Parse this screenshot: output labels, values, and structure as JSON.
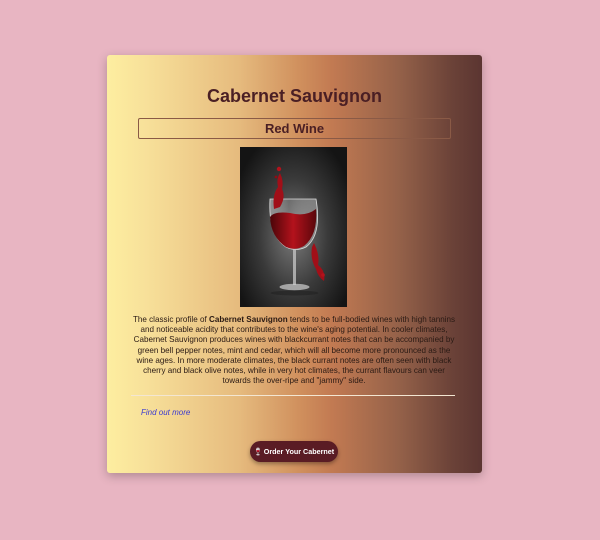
{
  "card": {
    "title": "Cabernet Sauvignon",
    "subtitle": "Red Wine",
    "image_alt": "Red wine splashing in a glass",
    "description_prefix": "The classic profile of ",
    "description_bold": "Cabernet Sauvignon",
    "description_suffix": " tends to be full-bodied wines with high tannins and noticeable acidity that contributes to the wine's aging potential. In cooler climates, Cabernet Sauvignon produces wines with blackcurrant notes that can be accompanied by green bell pepper notes, mint and cedar, which will all become more pronounced as the wine ages. In more moderate climates, the black currant notes are often seen with black cherry and black olive notes, while in very hot climates, the currant flavours can veer towards the over-ripe and \"jammy\" side.",
    "link_text": "Find out more",
    "button_icon": "🍷",
    "button_label": "Order Your Cabernet"
  },
  "colors": {
    "page_background": "#e8b5c2",
    "title_text": "#4a1f24",
    "button_background": "#5a1c24",
    "link": "#3a3ad0"
  }
}
